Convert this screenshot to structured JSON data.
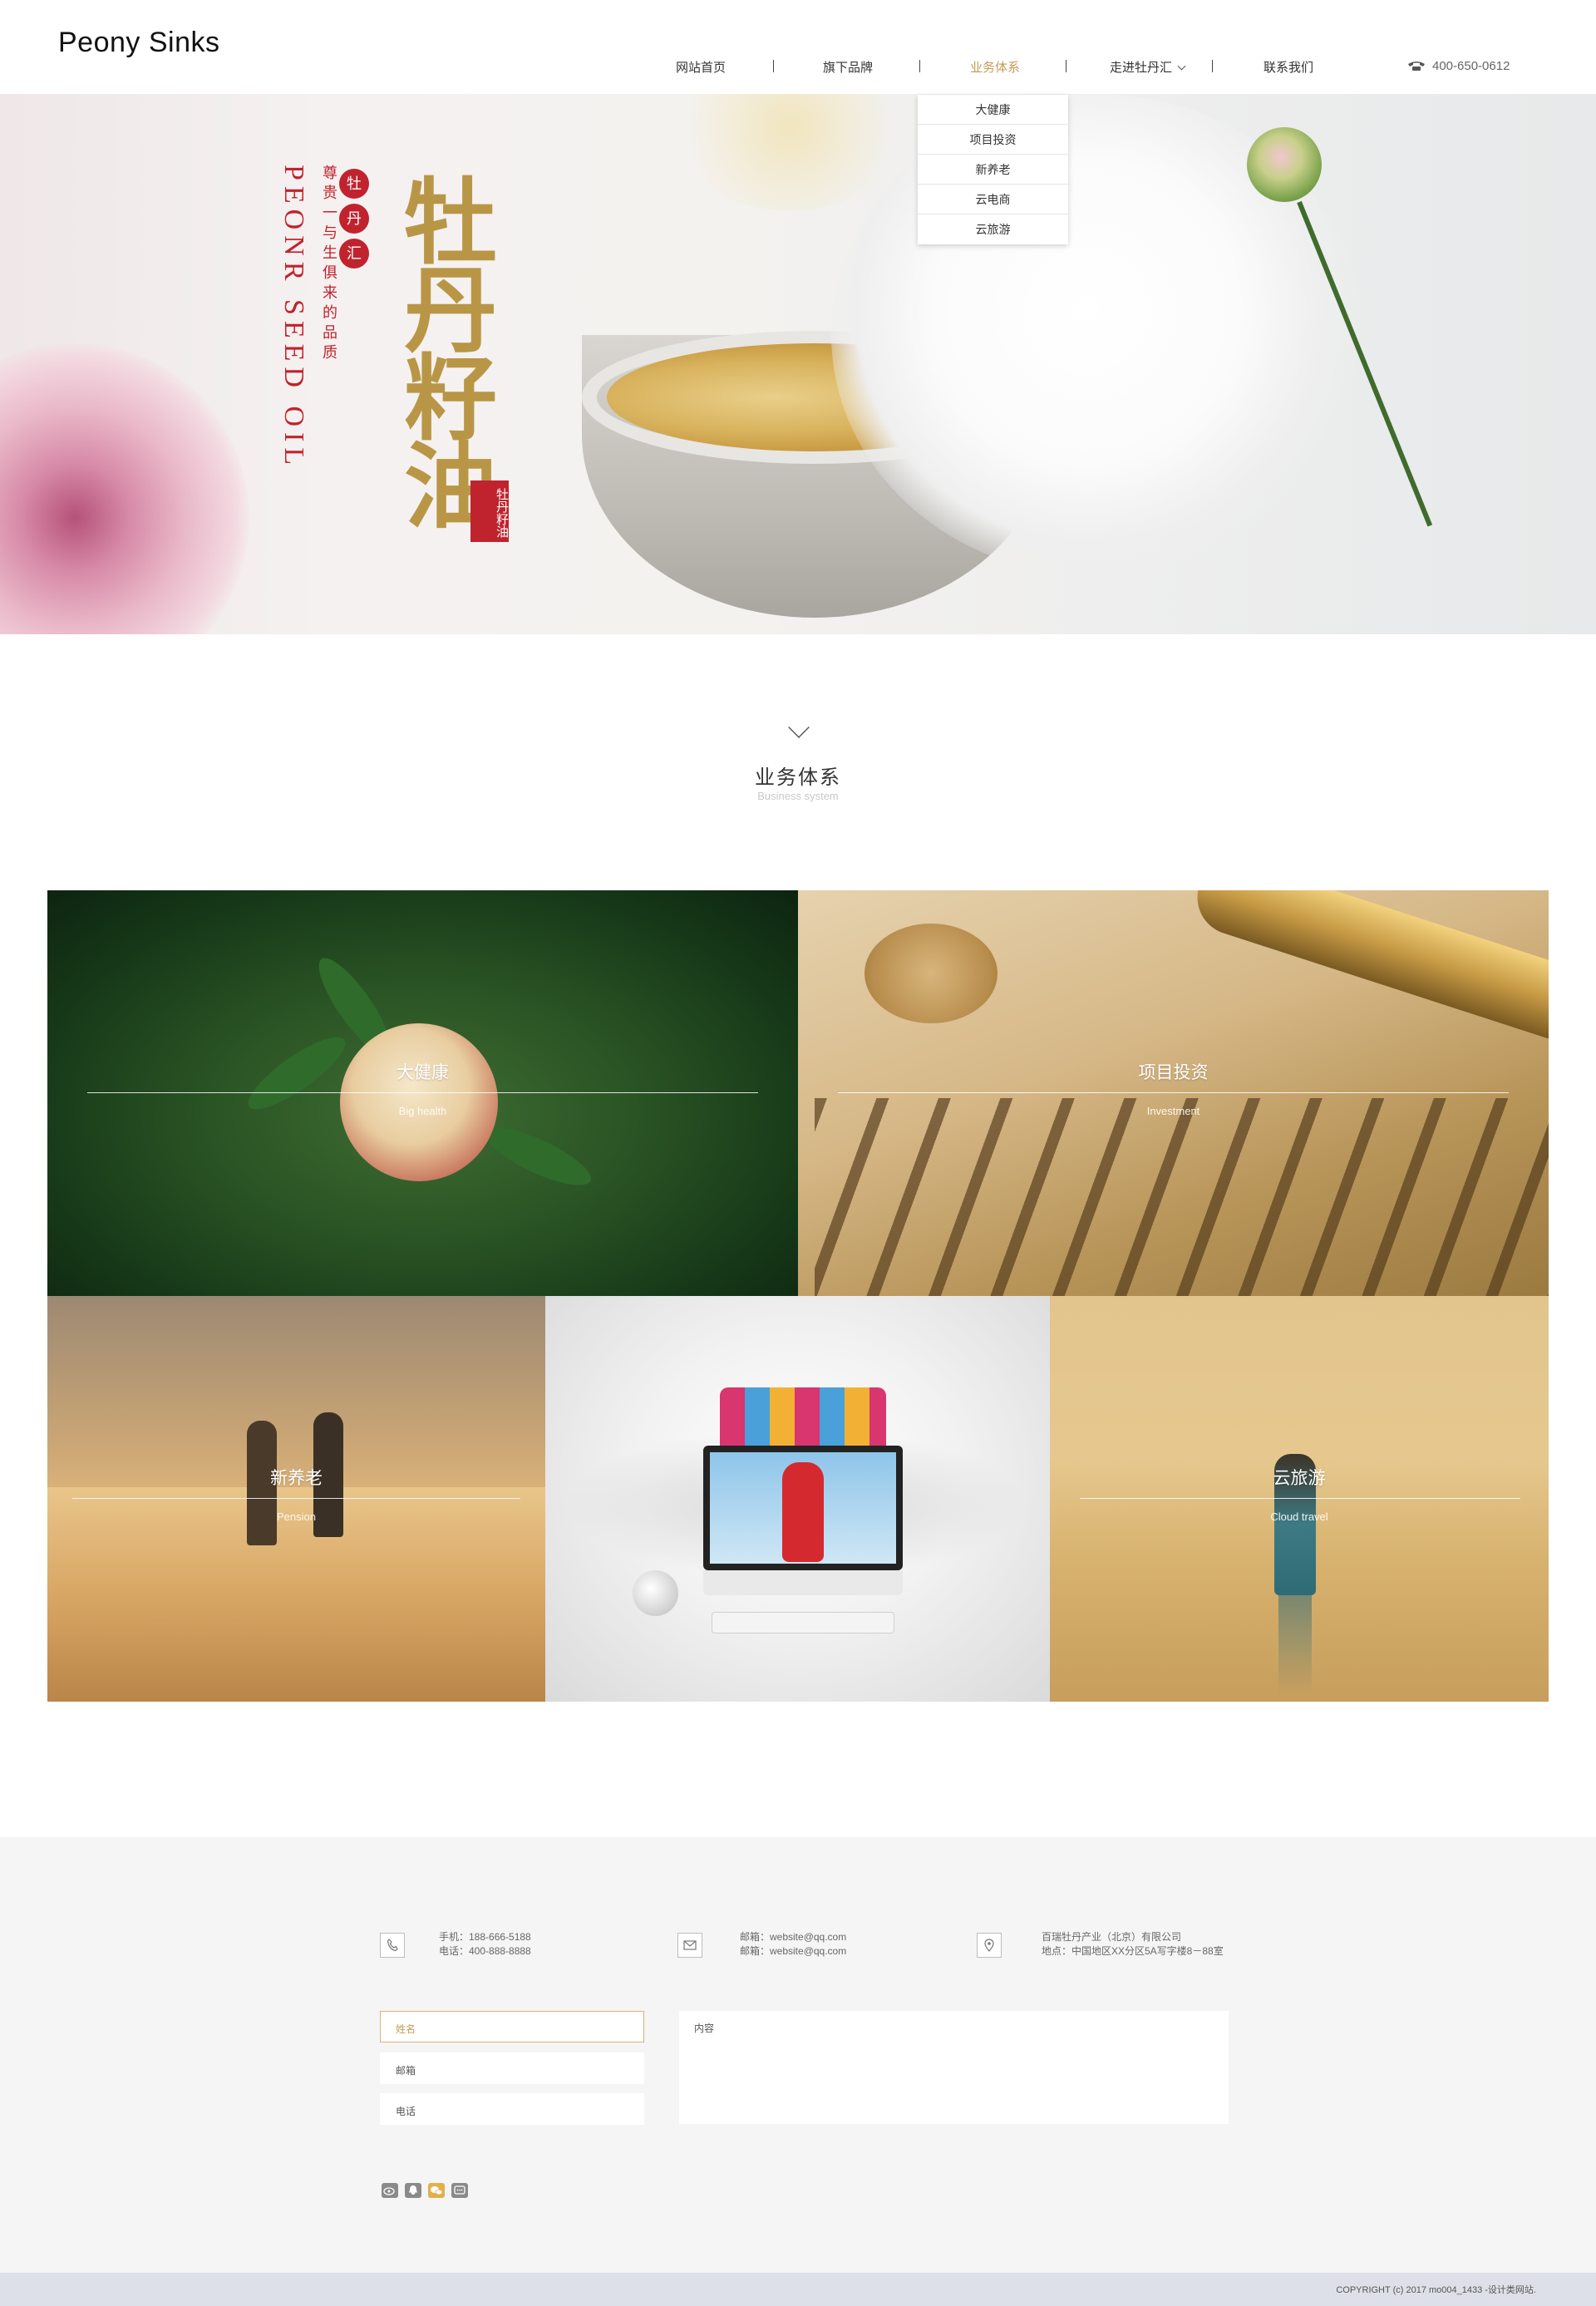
{
  "header": {
    "logo": "Peony Sinks",
    "nav": [
      {
        "label": "网站首页"
      },
      {
        "label": "旗下品牌"
      },
      {
        "label": "业务体系"
      },
      {
        "label": "走进牡丹汇"
      },
      {
        "label": "联系我们"
      }
    ],
    "phone": "400-650-0612"
  },
  "dropdown": [
    "大健康",
    "项目投资",
    "新养老",
    "云电商",
    "云旅游"
  ],
  "banner": {
    "small_cn": "尊贵一与生俱来的品质",
    "brand_badge": [
      "牡",
      "丹",
      "汇"
    ],
    "big_cn": "牡丹籽油",
    "en": "PEONR SEED OIL",
    "seal": "牡丹籽油"
  },
  "section": {
    "title": "业务体系",
    "subtitle": "Business system"
  },
  "tiles": [
    {
      "label": "大健康",
      "sub": "Big health"
    },
    {
      "label": "项目投资",
      "sub": "Investment"
    },
    {
      "label": "新养老",
      "sub": "Pension"
    },
    {
      "label": "",
      "sub": ""
    },
    {
      "label": "云旅游",
      "sub": "Cloud travel"
    }
  ],
  "contact": {
    "phone": [
      "手机：188-666-5188",
      "电话：400-888-8888"
    ],
    "email": [
      "邮箱：website@qq.com",
      "邮箱：website@qq.com"
    ],
    "address": [
      "百瑞牡丹产业（北京）有限公司",
      "地点：中国地区XX分区5A写字楼8－88室"
    ]
  },
  "form": {
    "name_placeholder": "姓名",
    "email_placeholder": "邮箱",
    "phone_placeholder": "电话",
    "content_placeholder": "内容"
  },
  "social_icons": [
    "weibo-icon",
    "qq-icon",
    "wechat-icon",
    "message-icon"
  ],
  "colors": {
    "accent": "#c59b58",
    "seal_red": "#c0232e",
    "footer_bg": "#f5f5f5"
  },
  "copyright": "COPYRIGHT (c) 2017 mo004_1433 -设计类网站."
}
